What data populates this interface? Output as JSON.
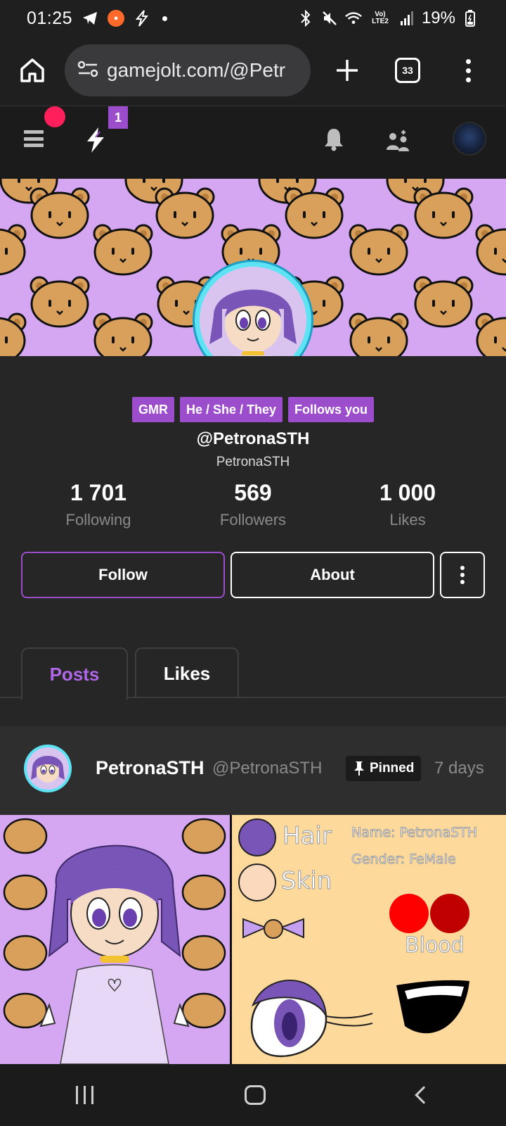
{
  "status_bar": {
    "time": "01:25",
    "network": "Vo) LTE2",
    "battery": "19%"
  },
  "browser": {
    "url": "gamejolt.com/@Petr",
    "tab_count": "33"
  },
  "app_bar": {
    "notification_badge": "1"
  },
  "profile": {
    "tags": [
      "GMR",
      "He / She / They",
      "Follows you"
    ],
    "handle": "@PetronaSTH",
    "display_name": "PetronaSTH",
    "stats": [
      {
        "value": "1 701",
        "label": "Following"
      },
      {
        "value": "569",
        "label": "Followers"
      },
      {
        "value": "1 000",
        "label": "Likes"
      }
    ],
    "follow_label": "Follow",
    "about_label": "About",
    "tabs": [
      "Posts",
      "Likes"
    ]
  },
  "post": {
    "author": "PetronaSTH",
    "handle": "@PetronaSTH",
    "pinned_label": "Pinned",
    "time": "7 days",
    "sheet": {
      "hair": "Hair",
      "skin": "Skin",
      "name": "Name: PetronaSTH",
      "gender": "Gender: FeMale",
      "blood": "Blood"
    }
  },
  "colors": {
    "accent": "#9b4dcc",
    "banner": "#d5a6f2",
    "sheet_bg": "#fdd99c"
  }
}
